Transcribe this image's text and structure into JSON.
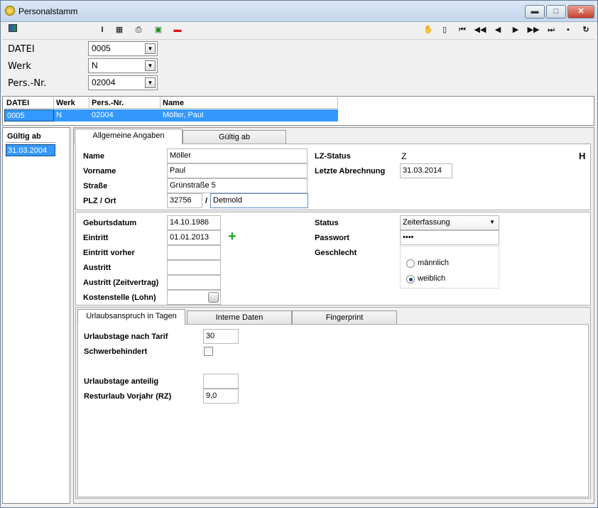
{
  "window": {
    "title": "Personalstamm",
    "btn_min": "▬",
    "btn_max": "□",
    "btn_close": "✕"
  },
  "toolbar": {
    "icons": [
      "new-window-icon",
      "cursor-icon",
      "calculator-icon",
      "print-icon",
      "money-icon",
      "delete-icon",
      "wizard-icon",
      "document-icon",
      "first-icon",
      "prev-page-icon",
      "prev-icon",
      "next-icon",
      "next-page-icon",
      "last-icon",
      "save-icon",
      "refresh-icon"
    ]
  },
  "header": {
    "datei_label": "DATEI",
    "datei_value": "0005",
    "werk_label": "Werk",
    "werk_value": "N",
    "persnr_label": "Pers.-Nr.",
    "persnr_value": "02004"
  },
  "grid": {
    "columns": [
      "DATEI",
      "Werk",
      "Pers.-Nr.",
      "Name"
    ],
    "rows": [
      [
        "0005",
        "N",
        "02004",
        "Möller, Paul"
      ]
    ]
  },
  "left_list": {
    "header": "Gültig ab",
    "items": [
      "31.03.2004"
    ]
  },
  "tabs": {
    "general": "Allgemeine Angaben",
    "valid_from": "Gültig ab"
  },
  "general": {
    "name_label": "Name",
    "name_value": "Möller",
    "vorname_label": "Vorname",
    "vorname_value": "Paul",
    "strasse_label": "Straße",
    "strasse_value": "Grünstraße 5",
    "plz_label": "PLZ / Ort",
    "plz_value": "32756",
    "slash": "/",
    "ort_value": "Detmold",
    "lz_status_label": "LZ-Status",
    "lz_status_value": "Z",
    "letzte_label": "Letzte Abrechnung",
    "letzte_value": "31.03.2014",
    "h_flag": "H"
  },
  "details": {
    "geburtsdatum_label": "Geburtsdatum",
    "geburtsdatum_value": "14.10.1986",
    "eintritt_label": "Eintritt",
    "eintritt_value": "01.01.2013",
    "eintritt_vorher_label": "Eintritt vorher",
    "eintritt_vorher_value": "",
    "austritt_label": "Austritt",
    "austritt_value": "",
    "austritt_zv_label": "Austritt (Zeitvertrag)",
    "austritt_zv_value": "",
    "kostenstelle_label": "Kostenstelle (Lohn)",
    "kostenstelle_value": "",
    "status_label": "Status",
    "status_value": "Zeiterfassung",
    "passwort_label": "Passwort",
    "passwort_value": "••••",
    "geschlecht_label": "Geschlecht",
    "male": "männlich",
    "female": "weiblich",
    "selected": "weiblich"
  },
  "subtabs": {
    "urlaub": "Urlaubsanspruch in Tagen",
    "interne": "Interne Daten",
    "finger": "Fingerprint"
  },
  "urlaub": {
    "tarif_label": "Urlaubstage nach Tarif",
    "tarif_value": "30",
    "schwer_label": "Schwerbehindert",
    "anteilig_label": "Urlaubstage anteilig",
    "anteilig_value": "",
    "rest_label": "Resturlaub Vorjahr (RZ)",
    "rest_value": "9,0"
  },
  "colors": {
    "selection": "#3399ff",
    "accent_green": "#22aa22"
  }
}
